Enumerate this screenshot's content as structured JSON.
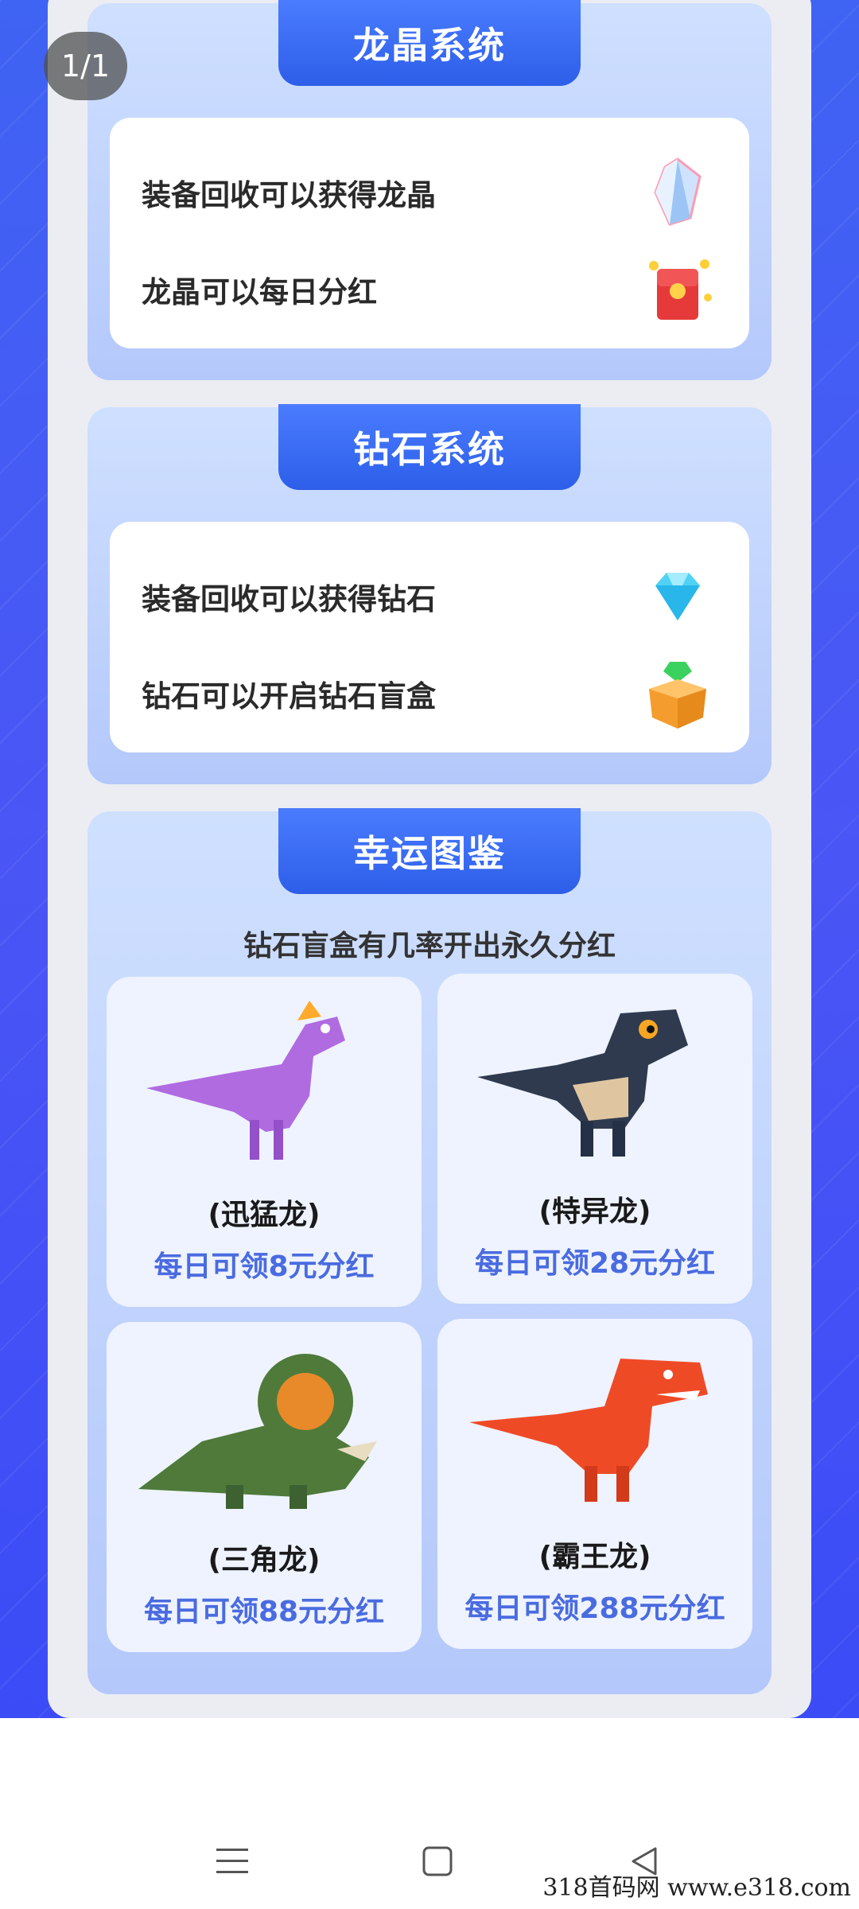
{
  "viewer": {
    "page_counter": "1/1"
  },
  "sections": {
    "dragon_crystal": {
      "title": "龙晶系统",
      "rows": [
        {
          "text": "装备回收可以获得龙晶",
          "icon": "crystal-icon"
        },
        {
          "text": "龙晶可以每日分红",
          "icon": "red-envelope-icon"
        }
      ]
    },
    "diamond": {
      "title": "钻石系统",
      "rows": [
        {
          "text": "装备回收可以获得钻石",
          "icon": "diamond-icon"
        },
        {
          "text": "钻石可以开启钻石盲盒",
          "icon": "blind-box-icon"
        }
      ]
    },
    "lucky": {
      "title": "幸运图鉴",
      "subtitle": "钻石盲盒有几率开出永久分红",
      "dinos": [
        {
          "name": "(迅猛龙)",
          "reward": "每日可领8元分红",
          "color": "#b06be0"
        },
        {
          "name": "(特异龙)",
          "reward": "每日可领28元分红",
          "color": "#2f3a4f"
        },
        {
          "name": "(三角龙)",
          "reward": "每日可领88元分红",
          "color": "#4f7a3a"
        },
        {
          "name": "(霸王龙)",
          "reward": "每日可领288元分红",
          "color": "#ef4a26"
        }
      ]
    }
  },
  "navbar": {
    "icons": [
      "menu-icon",
      "home-square-icon",
      "back-triangle-icon"
    ]
  },
  "watermark": "318首码网  www.e318.com",
  "colors": {
    "accent": "#2d5ee9",
    "reward_text": "#4a6be0",
    "background_blue": "#3f63f3"
  }
}
